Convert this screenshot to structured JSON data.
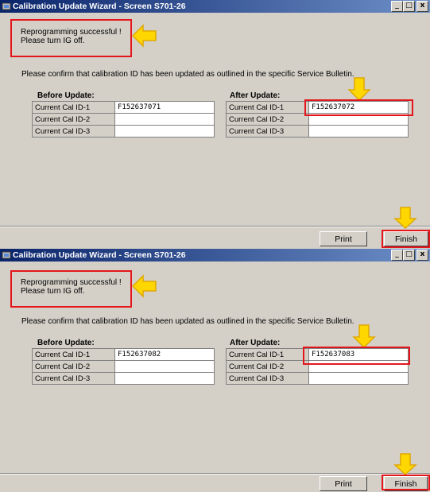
{
  "windows": [
    {
      "title": "Calibration Update Wizard - Screen S701-26",
      "message_line1": "Reprogramming successful !",
      "message_line2": "Please turn IG off.",
      "instruction": "Please confirm that calibration ID has been updated as outlined in the specific Service Bulletin.",
      "before": {
        "label": "Before Update:",
        "rows": [
          {
            "name": "Current Cal ID-1",
            "value": "F152637071"
          },
          {
            "name": "Current Cal ID-2",
            "value": ""
          },
          {
            "name": "Current Cal ID-3",
            "value": ""
          }
        ]
      },
      "after": {
        "label": "After Update:",
        "rows": [
          {
            "name": "Current Cal ID-1",
            "value": "F152637072"
          },
          {
            "name": "Current Cal ID-2",
            "value": ""
          },
          {
            "name": "Current Cal ID-3",
            "value": ""
          }
        ]
      },
      "print_label": "Print",
      "finish_label": "Finish"
    },
    {
      "title": "Calibration Update Wizard - Screen S701-26",
      "message_line1": "Reprogramming successful !",
      "message_line2": "Please turn IG off.",
      "instruction": "Please confirm that calibration ID has been updated as outlined in the specific Service Bulletin.",
      "before": {
        "label": "Before Update:",
        "rows": [
          {
            "name": "Current Cal ID-1",
            "value": "F152637082"
          },
          {
            "name": "Current Cal ID-2",
            "value": ""
          },
          {
            "name": "Current Cal ID-3",
            "value": ""
          }
        ]
      },
      "after": {
        "label": "After Update:",
        "rows": [
          {
            "name": "Current Cal ID-1",
            "value": "F152637083"
          },
          {
            "name": "Current Cal ID-2",
            "value": ""
          },
          {
            "name": "Current Cal ID-3",
            "value": ""
          }
        ]
      },
      "print_label": "Print",
      "finish_label": "Finish"
    }
  ],
  "window_buttons": {
    "minimize": "_",
    "maximize": "□",
    "close": "x"
  },
  "colors": {
    "highlight": "#e5161b",
    "arrow": "#ffd700",
    "titlebar": "#0a246a"
  }
}
